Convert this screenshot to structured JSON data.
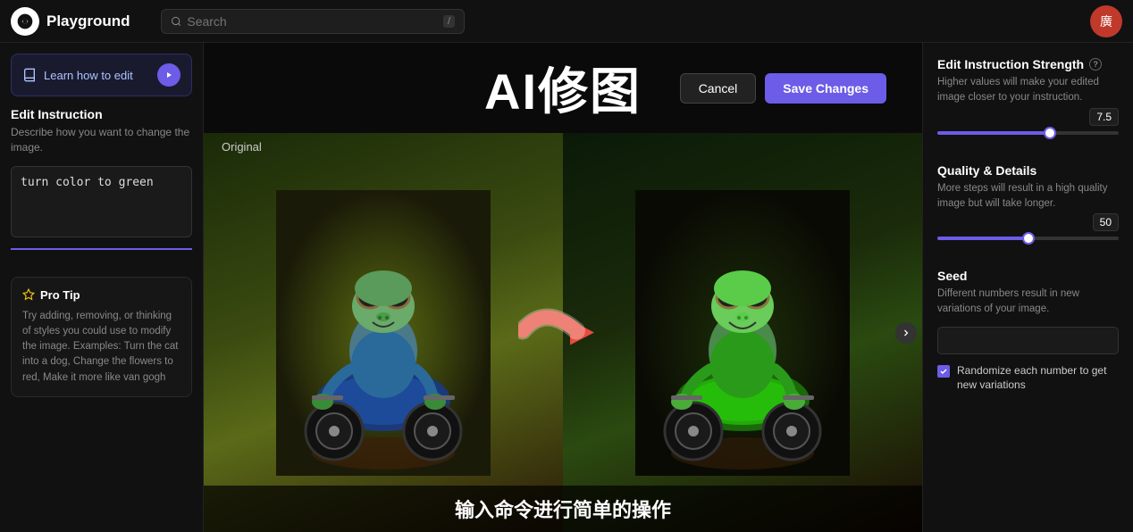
{
  "header": {
    "logo_text": "Playground",
    "search_placeholder": "Search",
    "search_shortcut": "/",
    "avatar_emoji": "廣"
  },
  "sidebar": {
    "learn_btn_label": "Learn how to edit",
    "edit_instruction_title": "Edit Instruction",
    "edit_instruction_desc": "Describe how you want to change the image.",
    "instruction_value": "turn color to green",
    "pro_tip_title": "Pro Tip",
    "pro_tip_text": "Try adding, removing, or thinking of styles you could use to modify the image. Examples: Turn the cat into a dog, Change the flowers to red, Make it more like van gogh"
  },
  "center": {
    "ai_title": "AI修图",
    "cancel_label": "Cancel",
    "save_label": "Save Changes",
    "original_label": "Original",
    "subtitle": "输入命令进行简单的操作"
  },
  "right_panel": {
    "strength_title": "Edit Instruction Strength",
    "strength_desc": "Higher values will make your edited image closer to your instruction.",
    "strength_value": "7.5",
    "strength_pct": 62,
    "quality_title": "Quality & Details",
    "quality_desc": "More steps will result in a high quality image but will take longer.",
    "quality_value": "50",
    "quality_pct": 50,
    "seed_title": "Seed",
    "seed_desc": "Different numbers result in new variations of your image.",
    "seed_placeholder": "",
    "randomize_label": "Randomize each number to get new variations"
  }
}
